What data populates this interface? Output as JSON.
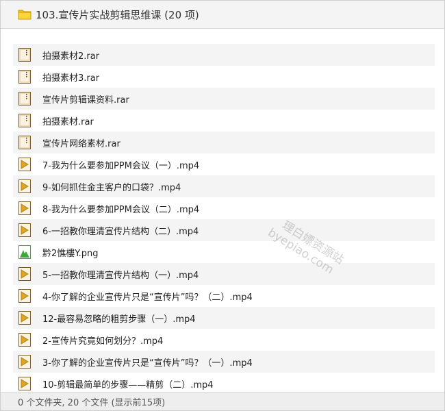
{
  "window": {
    "title": "103.宣传片实战剪辑思维课 (20 项)"
  },
  "files": [
    {
      "name": "拍摄素材2.rar",
      "type": "archive"
    },
    {
      "name": "拍摄素材3.rar",
      "type": "archive"
    },
    {
      "name": "宣传片剪辑课资料.rar",
      "type": "archive"
    },
    {
      "name": "拍摄素材.rar",
      "type": "archive"
    },
    {
      "name": "宣传片网络素材.rar",
      "type": "archive"
    },
    {
      "name": "7-我为什么要参加PPM会议（一）.mp4",
      "type": "video"
    },
    {
      "name": "9-如何抓住金主客户的口袋？.mp4",
      "type": "video"
    },
    {
      "name": "8-我为什么要参加PPM会议（二）.mp4",
      "type": "video"
    },
    {
      "name": "6-一招教你理清宣传片结构（二）.mp4",
      "type": "video"
    },
    {
      "name": "黔2憔樓Y.png",
      "type": "image"
    },
    {
      "name": "5-一招教你理清宣传片结构（一）.mp4",
      "type": "video"
    },
    {
      "name": "4-你了解的企业宣传片只是“宣传片”吗？（二）.mp4",
      "type": "video"
    },
    {
      "name": "12-最容易忽略的粗剪步骤（一）.mp4",
      "type": "video"
    },
    {
      "name": "2-宣传片究竟如何划分？.mp4",
      "type": "video"
    },
    {
      "name": "3-你了解的企业宣传片只是“宣传片”吗？（一）.mp4",
      "type": "video"
    },
    {
      "name": "10-剪辑最简单的步骤——精剪（二）.mp4",
      "type": "video"
    }
  ],
  "status": {
    "text": "0 个文件夹, 20 个文件 (显示前15项)"
  },
  "watermark": {
    "line1": "理白嫖资源站",
    "line2": "byepiao.com"
  },
  "icons": {
    "folder": "folder-icon",
    "archive": "archive-icon",
    "video": "video-icon",
    "image": "image-icon"
  }
}
